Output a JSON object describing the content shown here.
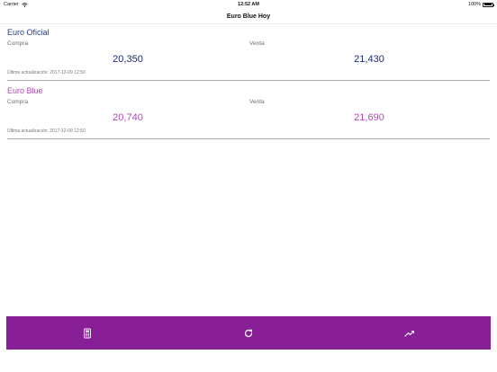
{
  "status_bar": {
    "carrier": "Carrier",
    "time": "12:52 AM",
    "battery": "100%"
  },
  "nav": {
    "title": "Euro Blue Hoy"
  },
  "sections": [
    {
      "title": "Euro Oficial",
      "buy_label": "Compra",
      "buy_value": "20,350",
      "sell_label": "Venta",
      "sell_value": "21,430",
      "updated": "Última actualización: 2017-12-09 12:50"
    },
    {
      "title": "Euro Blue",
      "buy_label": "Compra",
      "buy_value": "20,740",
      "sell_label": "Venta",
      "sell_value": "21,690",
      "updated": "Última actualización: 2017-12-09 12:50"
    }
  ],
  "tab_bar": {
    "background": "#881f96",
    "tabs": [
      {
        "icon": "calculator-icon"
      },
      {
        "icon": "refresh-icon"
      },
      {
        "icon": "trending-up-icon"
      }
    ]
  },
  "colors": {
    "oficial": "#2a3a8c",
    "blue": "#b04ab4"
  }
}
